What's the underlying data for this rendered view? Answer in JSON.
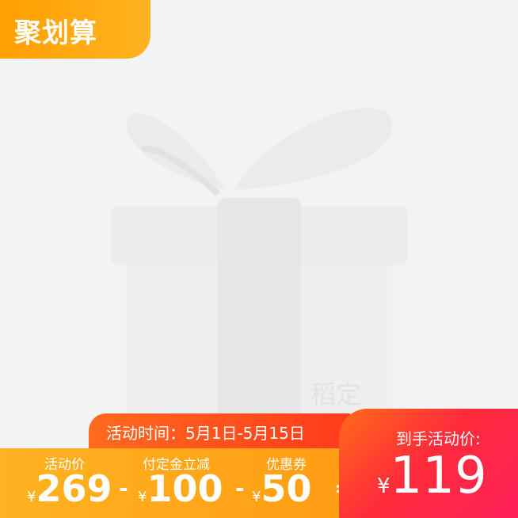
{
  "badge": {
    "text": "聚划算"
  },
  "image": {
    "watermark": "稻定"
  },
  "campaign": {
    "time_text": "活动时间：5月1日-5月15日"
  },
  "prices": [
    {
      "label": "活动价",
      "currency": "¥",
      "value": "269"
    },
    {
      "label": "付定金立减",
      "currency": "¥",
      "value": "100"
    },
    {
      "label": "优惠券",
      "currency": "¥",
      "value": "50"
    }
  ],
  "operators": {
    "minus1": "-",
    "minus2": "-",
    "equals": "="
  },
  "final": {
    "label": "到手活动价:",
    "currency": "¥",
    "value": "119"
  },
  "colors": {
    "badge": "#ffa510",
    "banner": "#ffa51a",
    "accent_red": "#ff2d3a"
  }
}
